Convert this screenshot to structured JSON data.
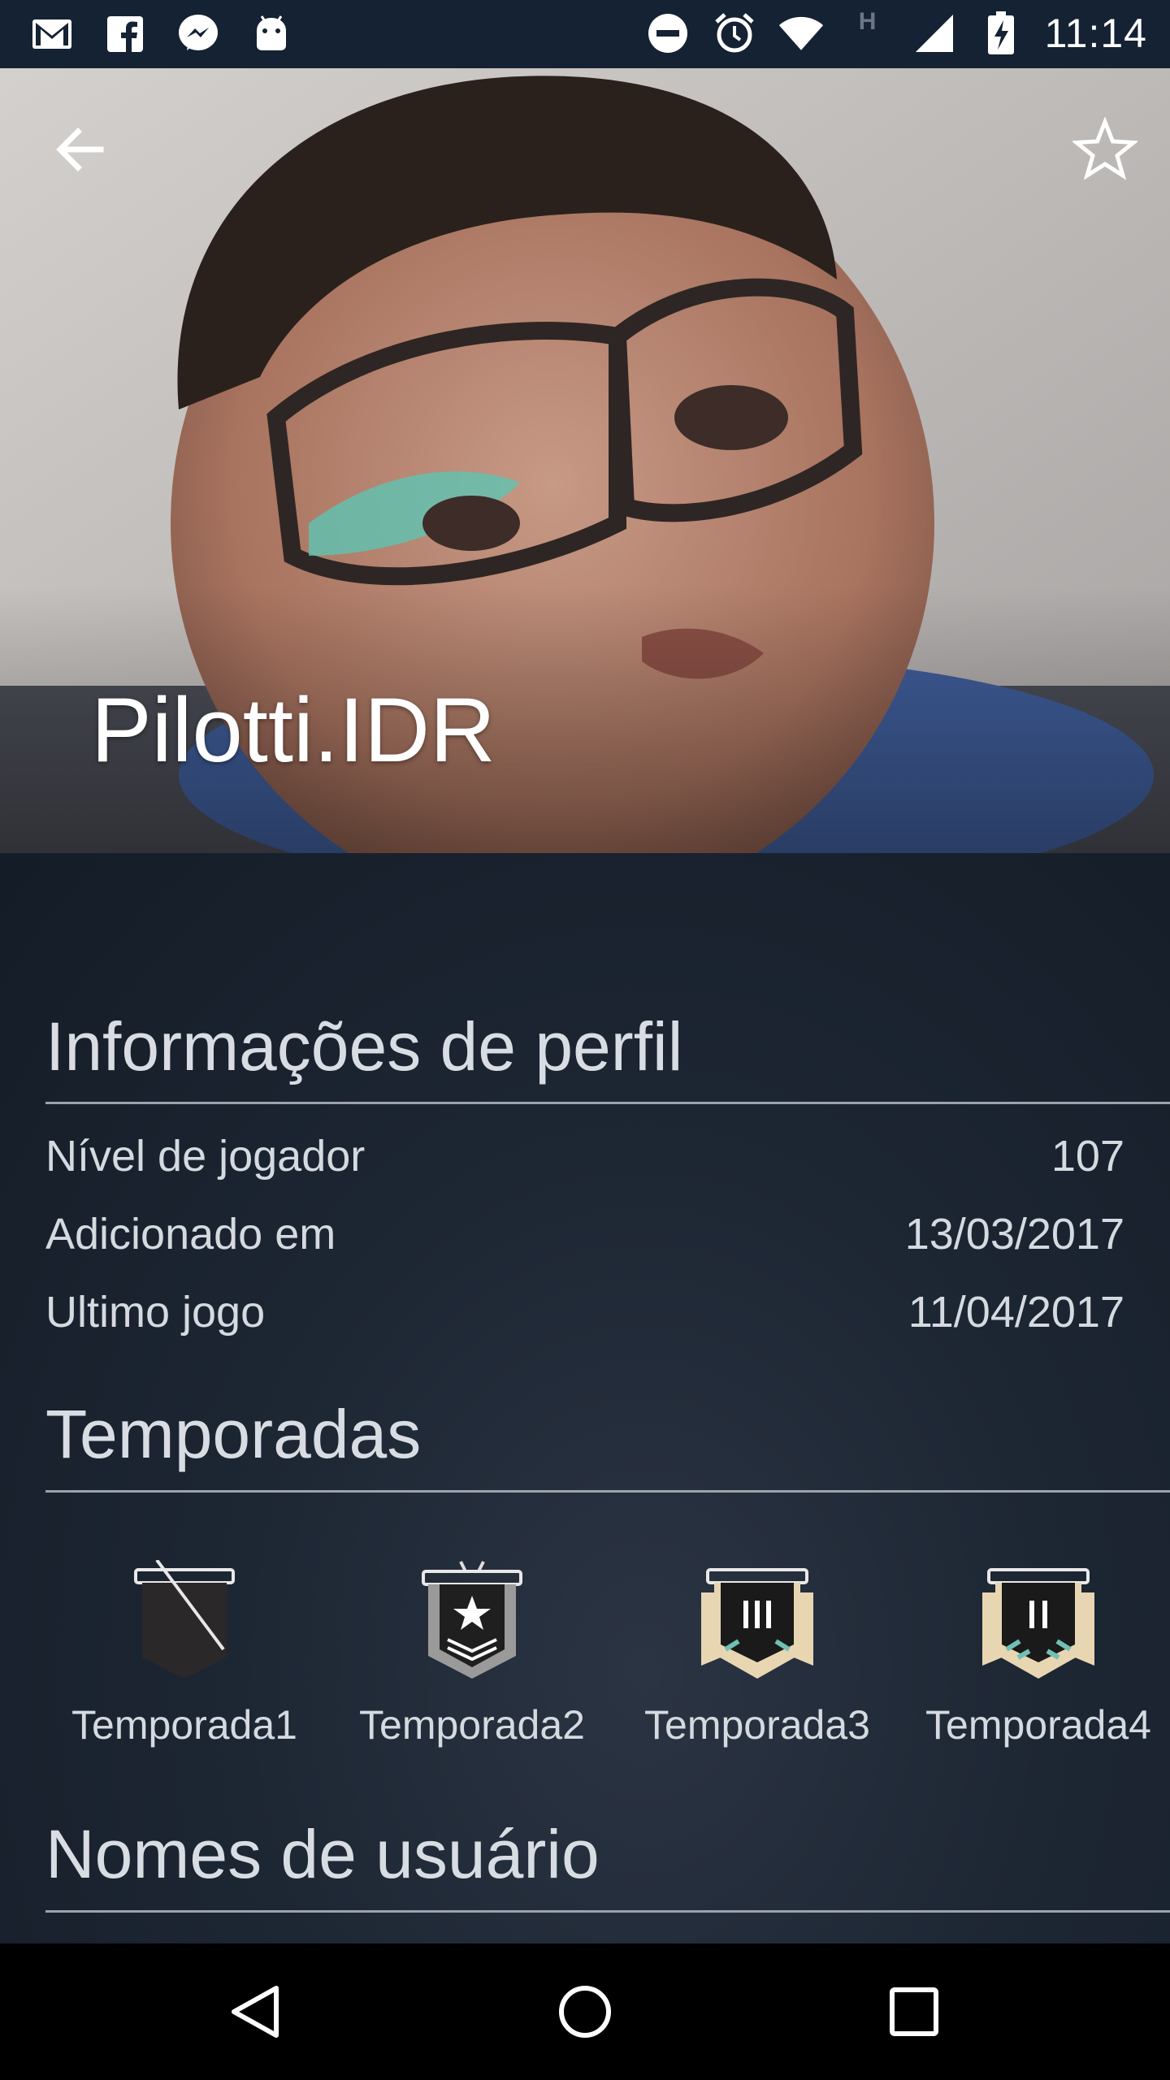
{
  "status_bar": {
    "time": "11:14",
    "left_icons": [
      "gmail-icon",
      "facebook-icon",
      "messenger-icon",
      "android-icon"
    ],
    "right_icons": [
      "do-not-disturb-icon",
      "alarm-icon",
      "wifi-icon",
      "h-network-icon",
      "signal-icon",
      "battery-charging-icon"
    ],
    "network_type": "H"
  },
  "header": {
    "profile_name": "Pilotti.IDR",
    "back_icon": "arrow-back-icon",
    "favorite_icon": "star-outline-icon"
  },
  "profile_info": {
    "title": "Informações de perfil",
    "rows": [
      {
        "label": "Nível de jogador",
        "value": "107"
      },
      {
        "label": "Adicionado em",
        "value": "13/03/2017"
      },
      {
        "label": "Ultimo jogo",
        "value": "11/04/2017"
      }
    ]
  },
  "seasons": {
    "title": "Temporadas",
    "items": [
      {
        "label": "Temporada1",
        "icon": "unranked-badge-icon"
      },
      {
        "label": "Temporada2",
        "icon": "silver-star-badge-icon"
      },
      {
        "label": "Temporada3",
        "icon": "gold-III-badge-icon"
      },
      {
        "label": "Temporada4",
        "icon": "gold-II-badge-icon"
      }
    ]
  },
  "usernames": {
    "title": "Nomes de usuário"
  },
  "nav_bar": {
    "icons": [
      "nav-back-icon",
      "nav-home-icon",
      "nav-recents-icon"
    ]
  }
}
